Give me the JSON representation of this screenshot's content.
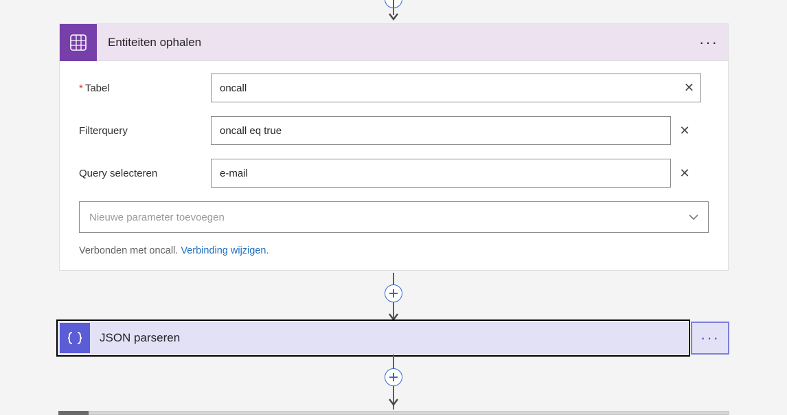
{
  "action1": {
    "title": "Entiteiten ophalen",
    "fields": {
      "tabel": {
        "label": "Tabel",
        "required": true,
        "value": "oncall"
      },
      "filterquery": {
        "label": "Filterquery",
        "value": "oncall eq true"
      },
      "selectquery": {
        "label": "Query selecteren",
        "value": "e-mail"
      }
    },
    "add_param_placeholder": "Nieuwe parameter toevoegen",
    "connection_prefix": "Verbonden met oncall. ",
    "connection_link": "Verbinding wijzigen."
  },
  "action2": {
    "title": "JSON parseren"
  }
}
